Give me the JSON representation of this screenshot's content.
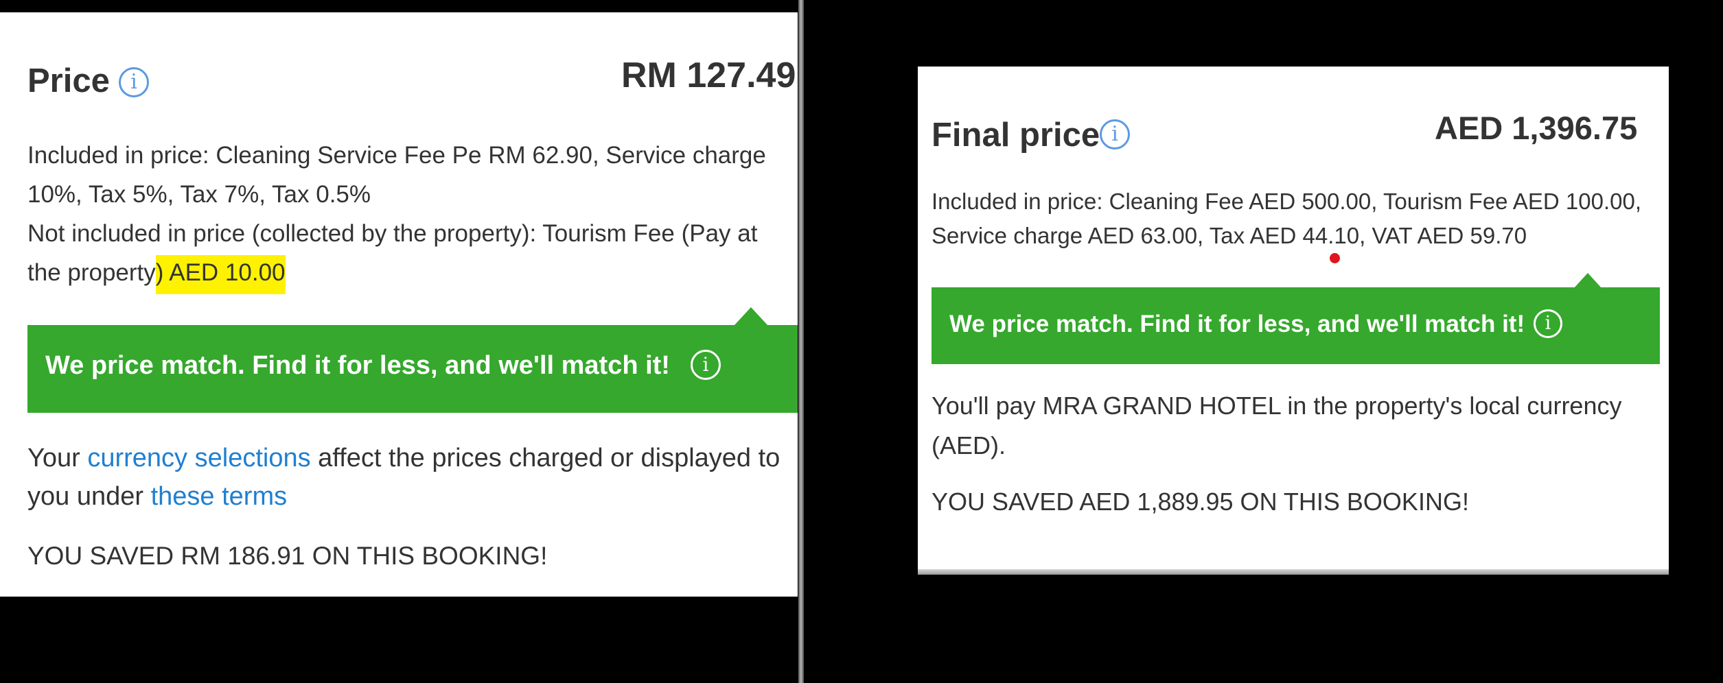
{
  "left": {
    "title": "Price",
    "amount": "RM 127.49",
    "included_label": "Included in price:",
    "included_value": " Cleaning Service Fee Pe RM 62.90, Service charge 10%, Tax 5%, Tax 7%, Tax 0.5%",
    "not_included_label": "Not included in price (collected by the property):",
    "not_included_value_plain": " Tourism Fee (Pay at the property",
    "not_included_value_highlight": ") AED 10.00",
    "banner_text": "We price match. Find it for less, and we'll match it!",
    "currency_text_1": "Your ",
    "currency_link": "currency selections",
    "currency_text_2": " affect the prices charged or displayed to you under ",
    "terms_link": "these terms",
    "saved_text": "YOU SAVED RM 186.91 ON THIS BOOKING!",
    "highlight_color": "#fff200"
  },
  "right": {
    "title": "Final price",
    "amount": "AED 1,396.75",
    "included_label": "Included in price:",
    "included_value": " Cleaning Fee AED 500.00, Tourism Fee AED 100.00, Service charge AED 63.00, Tax AED 44.10, VAT AED 59.70",
    "banner_text": "We price match. Find it for less, and we'll match it!",
    "local_text": "You'll pay MRA GRAND HOTEL in the property's local currency (AED).",
    "saved_text": "YOU SAVED AED 1,889.95 ON THIS BOOKING!"
  },
  "icons": {
    "info": "info-icon",
    "info_glyph": "i"
  },
  "colors": {
    "banner_green": "#35a82d",
    "link_blue": "#1f7fd1",
    "info_blue": "#5b9ae0",
    "annotation_red": "#e0141e"
  }
}
